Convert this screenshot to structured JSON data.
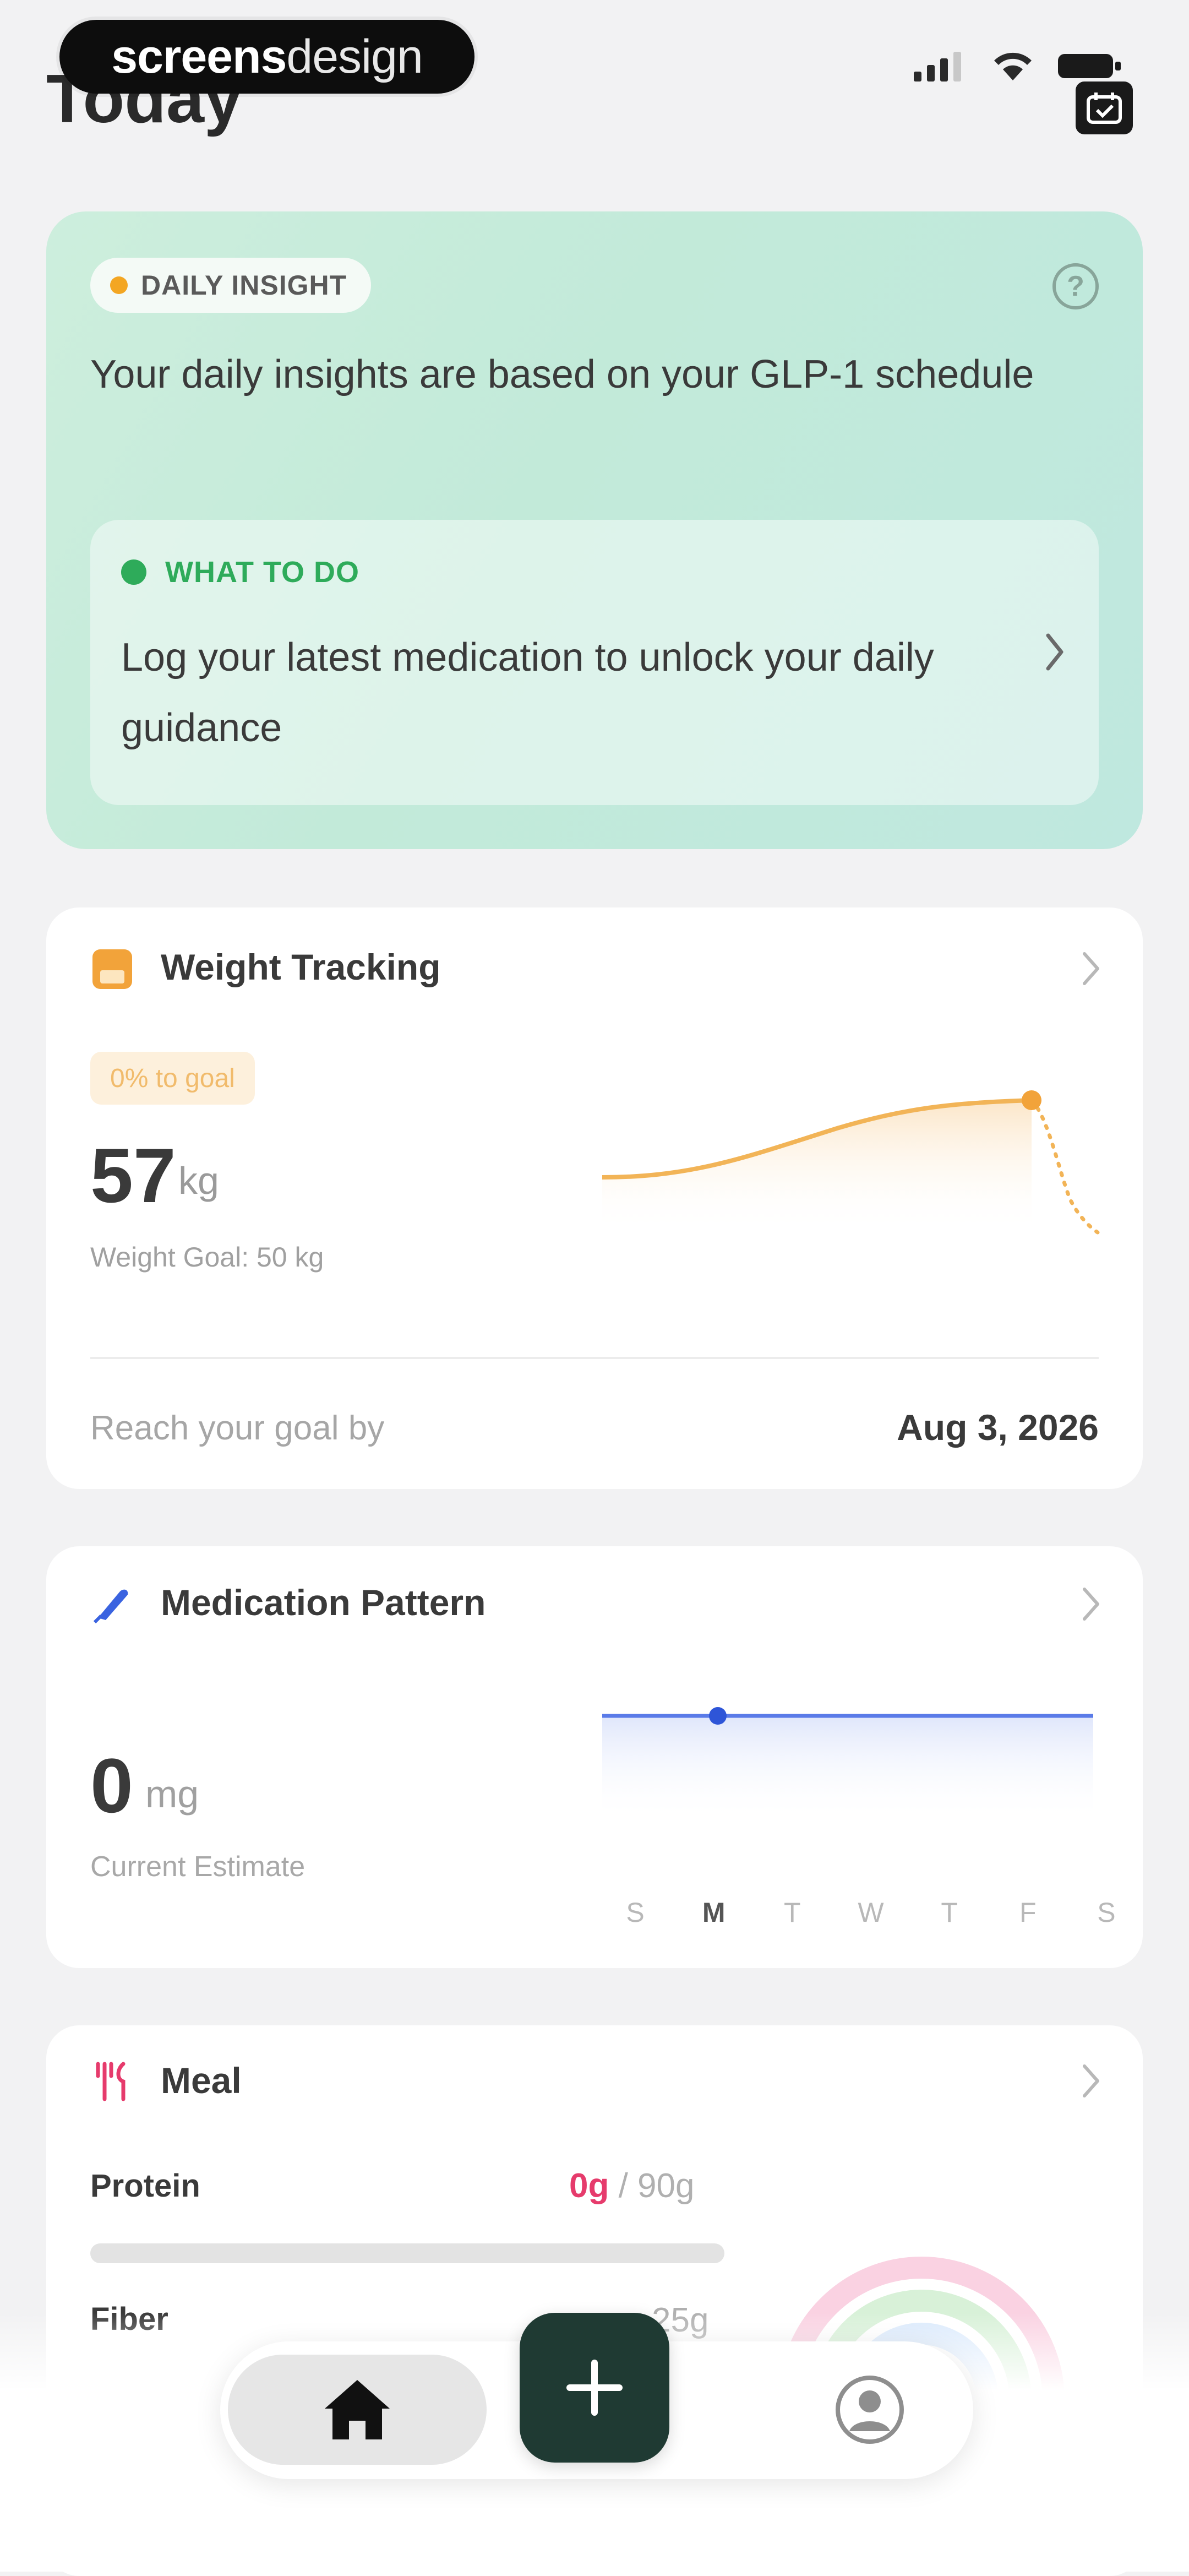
{
  "header": {
    "title": "Today",
    "watermark_bold": "screens",
    "watermark_light": "design"
  },
  "insight": {
    "badge": "DAILY INSIGHT",
    "text": "Your daily insights are based on your GLP-1 schedule",
    "todo_label": "WHAT TO DO",
    "todo_text": "Log your latest medication to unlock your daily guidance"
  },
  "weight": {
    "title": "Weight Tracking",
    "goal_badge": "0% to goal",
    "value": "57",
    "unit": "kg",
    "goal_text": "Weight Goal: 50 kg",
    "reach_label": "Reach your goal by",
    "reach_date": "Aug 3, 2026"
  },
  "medication": {
    "title": "Medication Pattern",
    "value": "0",
    "unit": "mg",
    "sub": "Current Estimate",
    "days": [
      "S",
      "M",
      "T",
      "W",
      "T",
      "F",
      "S"
    ]
  },
  "meal": {
    "title": "Meal",
    "protein_label": "Protein",
    "protein_current": "0g",
    "protein_goal": " / 90g",
    "fiber_label": "Fiber",
    "fiber_goal": "25g"
  },
  "colors": {
    "insight_dot": "#f3a623",
    "todo_dot": "#2eab5a",
    "weight_accent": "#f2b457",
    "med_accent": "#3a63e0",
    "meal_accent": "#e63b6c",
    "add_button": "#1f3a33"
  },
  "icons": {
    "help": "?",
    "plus": "+"
  }
}
